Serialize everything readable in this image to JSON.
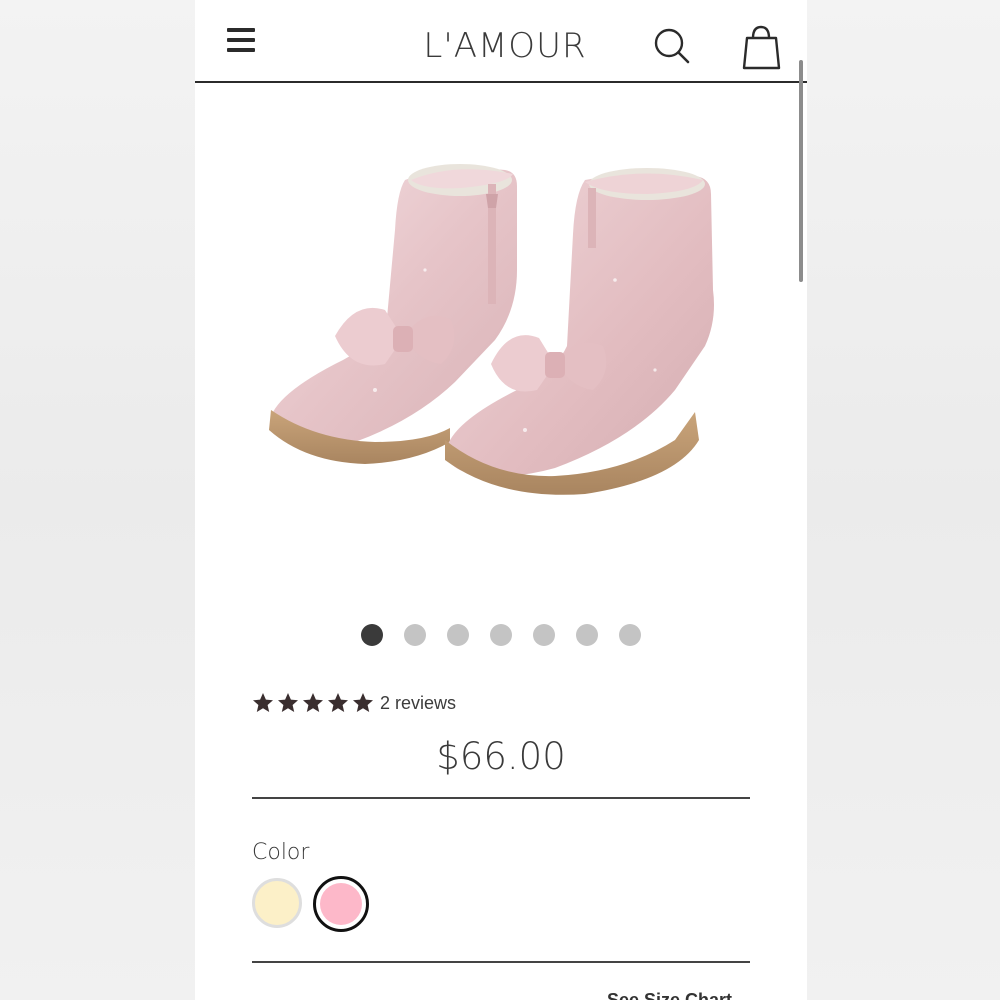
{
  "header": {
    "brand": "L'AMOUR",
    "menu_icon": "hamburger-menu-icon",
    "search_icon": "search-icon",
    "cart_icon": "shopping-bag-icon"
  },
  "product": {
    "image_alt": "pink glitter ankle boots with bow",
    "carousel": {
      "total": 7,
      "active": 1
    },
    "rating": {
      "stars": 5,
      "max": 5,
      "reviews_label": "2 reviews"
    },
    "price": "$66.00"
  },
  "options": {
    "color_label": "Color",
    "colors": [
      {
        "name": "cream",
        "hex": "#fcf0c8",
        "selected": false
      },
      {
        "name": "pink",
        "hex": "#fdb8c9",
        "selected": true
      }
    ]
  },
  "size_chart_label": "See Size Chart",
  "colors": {
    "star": "#3a2e2f",
    "dot_active": "#3a3a3a",
    "dot_inactive": "#c4c4c4"
  }
}
